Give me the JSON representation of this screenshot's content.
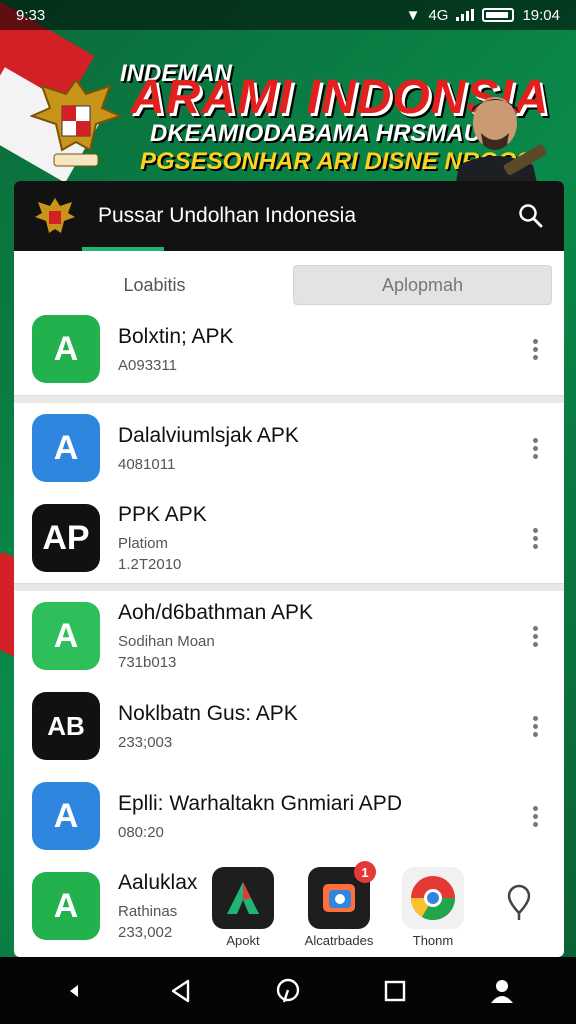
{
  "status_bar": {
    "time_left": "9:33",
    "network": "4G",
    "time_right": "19:04"
  },
  "banner": {
    "small_title": "INDEMAN",
    "title": "ARAMI INDONSIA",
    "subtitle1": "DKEAMIODABAMA HRSMAUAI",
    "subtitle2": "PGSESONHAR ARI DISNE NROO?"
  },
  "app_header": {
    "title": "Pussar Undolhan Indonesia",
    "search_icon": "search-icon"
  },
  "tabs": [
    {
      "label": "Loabitis",
      "active": false
    },
    {
      "label": "Aplopmah",
      "active": true
    }
  ],
  "apps": [
    {
      "name": "Bolxtin; APK",
      "sub": "A093311",
      "sub2": "",
      "icon_text": "A",
      "icon_color": "#22b14c"
    },
    {
      "name": "Dalalviumlsjak APK",
      "sub": "4081011",
      "sub2": "",
      "icon_text": "A",
      "icon_color": "#2e86de"
    },
    {
      "name": "PPK APK",
      "sub": "Platiom",
      "sub2": "1.2T2010",
      "icon_text": "AP",
      "icon_color": "#111111"
    },
    {
      "name": "Aoh/d6bathman APK",
      "sub": "Sodihan Moan",
      "sub2": "731b013",
      "icon_text": "A",
      "icon_color": "#2fbf5a"
    },
    {
      "name": "Noklbatn Gus: APK",
      "sub": "233;003",
      "sub2": "",
      "icon_text": "AB",
      "icon_color": "#111111"
    },
    {
      "name": "Eplli: Warhaltakn Gnmiari APD",
      "sub": "080:20",
      "sub2": "",
      "icon_text": "A",
      "icon_color": "#2e86de"
    },
    {
      "name": "Aaluklax",
      "sub": "Rathinas",
      "sub2": "233,002",
      "icon_text": "A",
      "icon_color": "#22b14c"
    }
  ],
  "dock": [
    {
      "label": "Apokt",
      "icon": "android-app-icon",
      "badge": ""
    },
    {
      "label": "Alcatrbades",
      "icon": "gallery-icon",
      "badge": "1"
    },
    {
      "label": "Thonm",
      "icon": "chrome-icon",
      "badge": ""
    }
  ],
  "nav": {
    "back_icon": "back-icon",
    "home_icon": "home-icon",
    "recents_icon": "recents-icon",
    "profile_icon": "profile-icon"
  }
}
